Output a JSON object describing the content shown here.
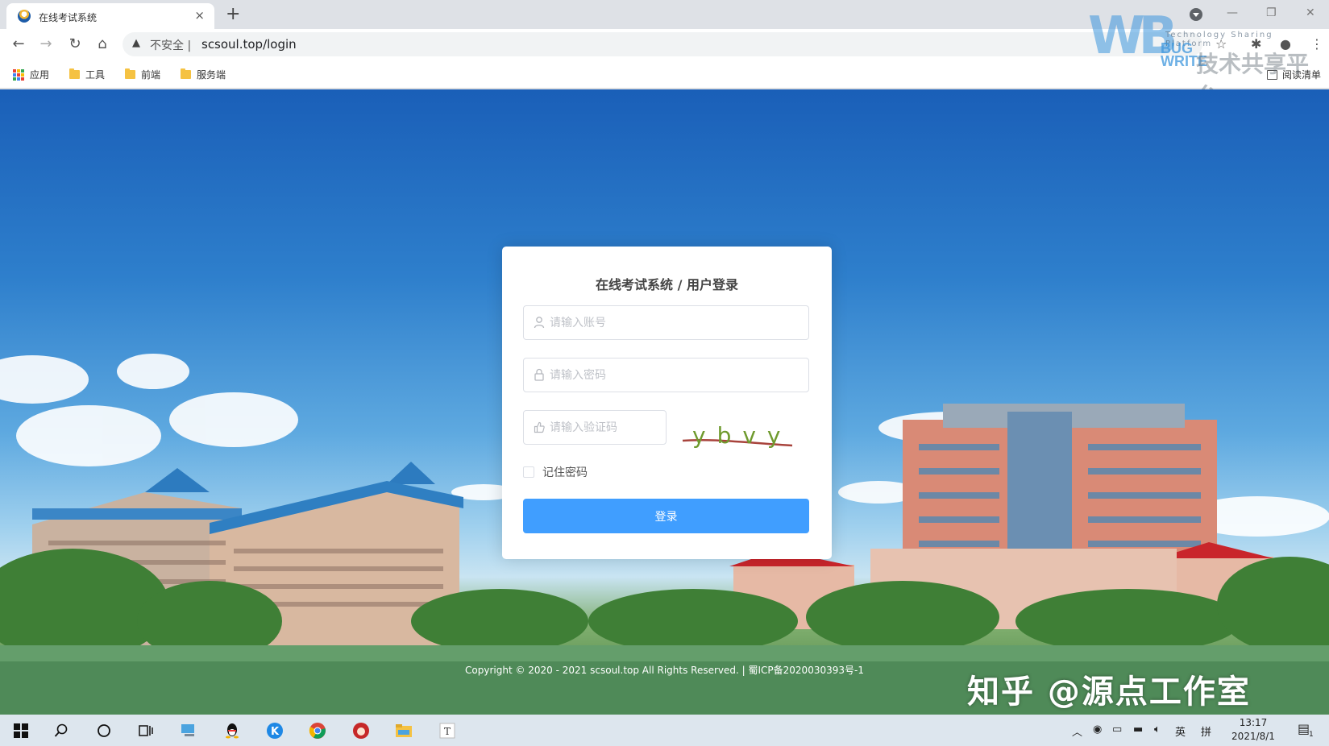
{
  "browser": {
    "tab_title": "在线考试系统",
    "tab_close": "×",
    "new_tab": "+",
    "security_label": "不安全",
    "url": "scsoul.top/login",
    "bookmarks": [
      "应用",
      "工具",
      "前端",
      "服务端"
    ],
    "reading_list": "阅读清单"
  },
  "watermark_logo": {
    "letters": "WB",
    "bug": "BUG",
    "write": "WRITE",
    "tagline": "Technology Sharing Platform",
    "cn": "技术共享平台"
  },
  "login": {
    "title": "在线考试系统 / 用户登录",
    "username_placeholder": "请输入账号",
    "password_placeholder": "请输入密码",
    "captcha_placeholder": "请输入验证码",
    "captcha_text": "ybvy",
    "remember_label": "记住密码",
    "submit_label": "登录"
  },
  "footer": {
    "copyright": "Copyright © 2020 - 2021 scsoul.top All Rights Reserved. | 蜀ICP备2020030393号-1"
  },
  "overlay_watermark": "知乎 @源点工作室",
  "taskbar": {
    "ime_lang": "英",
    "ime_mode": "拼",
    "time": "13:17",
    "date": "2021/8/1",
    "notification_count": "1"
  },
  "colors": {
    "primary": "#409eff",
    "chrome_bg": "#dee1e6",
    "taskbar_bg": "#dde6ee"
  }
}
